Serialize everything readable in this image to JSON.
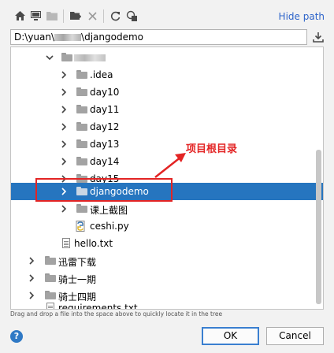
{
  "toolbar": {
    "icons": [
      "home-icon",
      "desktop-icon",
      "project-folder-icon",
      "new-folder-icon",
      "delete-icon",
      "refresh-icon",
      "show-hidden-icon"
    ],
    "hide_path_label": "Hide path"
  },
  "path": {
    "value_prefix": "D:\\yuan\\",
    "value_suffix": "\\djangodemo"
  },
  "tree": {
    "rows": [
      {
        "label": "",
        "kind": "folder",
        "expanded": true
      },
      {
        "label": ".idea",
        "kind": "folder"
      },
      {
        "label": "day10",
        "kind": "folder"
      },
      {
        "label": "day11",
        "kind": "folder"
      },
      {
        "label": "day12",
        "kind": "folder"
      },
      {
        "label": "day13",
        "kind": "folder"
      },
      {
        "label": "day14",
        "kind": "folder"
      },
      {
        "label": "day15",
        "kind": "folder"
      },
      {
        "label": "djangodemo",
        "kind": "folder",
        "selected": true
      },
      {
        "label": "课上截图",
        "kind": "folder"
      },
      {
        "label": "ceshi.py",
        "kind": "python-file"
      },
      {
        "label": "hello.txt",
        "kind": "text-file"
      },
      {
        "label": "迅雷下载",
        "kind": "folder"
      },
      {
        "label": "骑士一期",
        "kind": "folder"
      },
      {
        "label": "骑士四期",
        "kind": "folder"
      },
      {
        "label": "requirements.txt",
        "kind": "text-file"
      }
    ]
  },
  "hint_text": "Drag and drop a file into the space above to quickly locate it in the tree",
  "buttons": {
    "help": "?",
    "ok": "OK",
    "cancel": "Cancel"
  },
  "annotation": {
    "text": "项目根目录",
    "color": "#e32424"
  },
  "colors": {
    "selection": "#2675bf",
    "link": "#2f65ca",
    "ok_border": "#3a7fd0"
  }
}
